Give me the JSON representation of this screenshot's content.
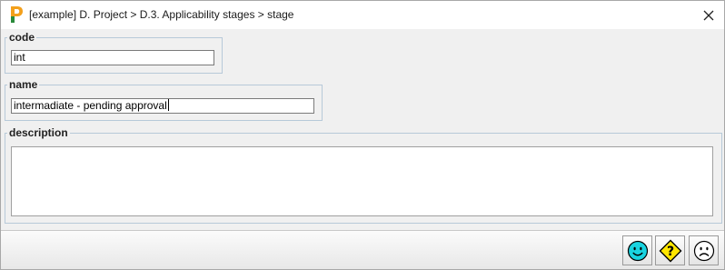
{
  "window": {
    "title": "[example] D. Project > D.3. Applicability stages > stage",
    "close_glyph": "✕",
    "app_icon": "p-logo-icon",
    "accent_color": "#f3a01c"
  },
  "form": {
    "code": {
      "label": "code",
      "value": "int"
    },
    "name": {
      "label": "name",
      "value": "intermadiate - pending approval"
    },
    "description": {
      "label": "description",
      "value": ""
    }
  },
  "buttons": {
    "ok": {
      "icon": "smiley-happy-icon",
      "color": "#19d3e0"
    },
    "help": {
      "icon": "question-diamond-icon",
      "color": "#ffe600"
    },
    "cancel": {
      "icon": "smiley-sad-icon",
      "color": "#ffffff"
    }
  }
}
